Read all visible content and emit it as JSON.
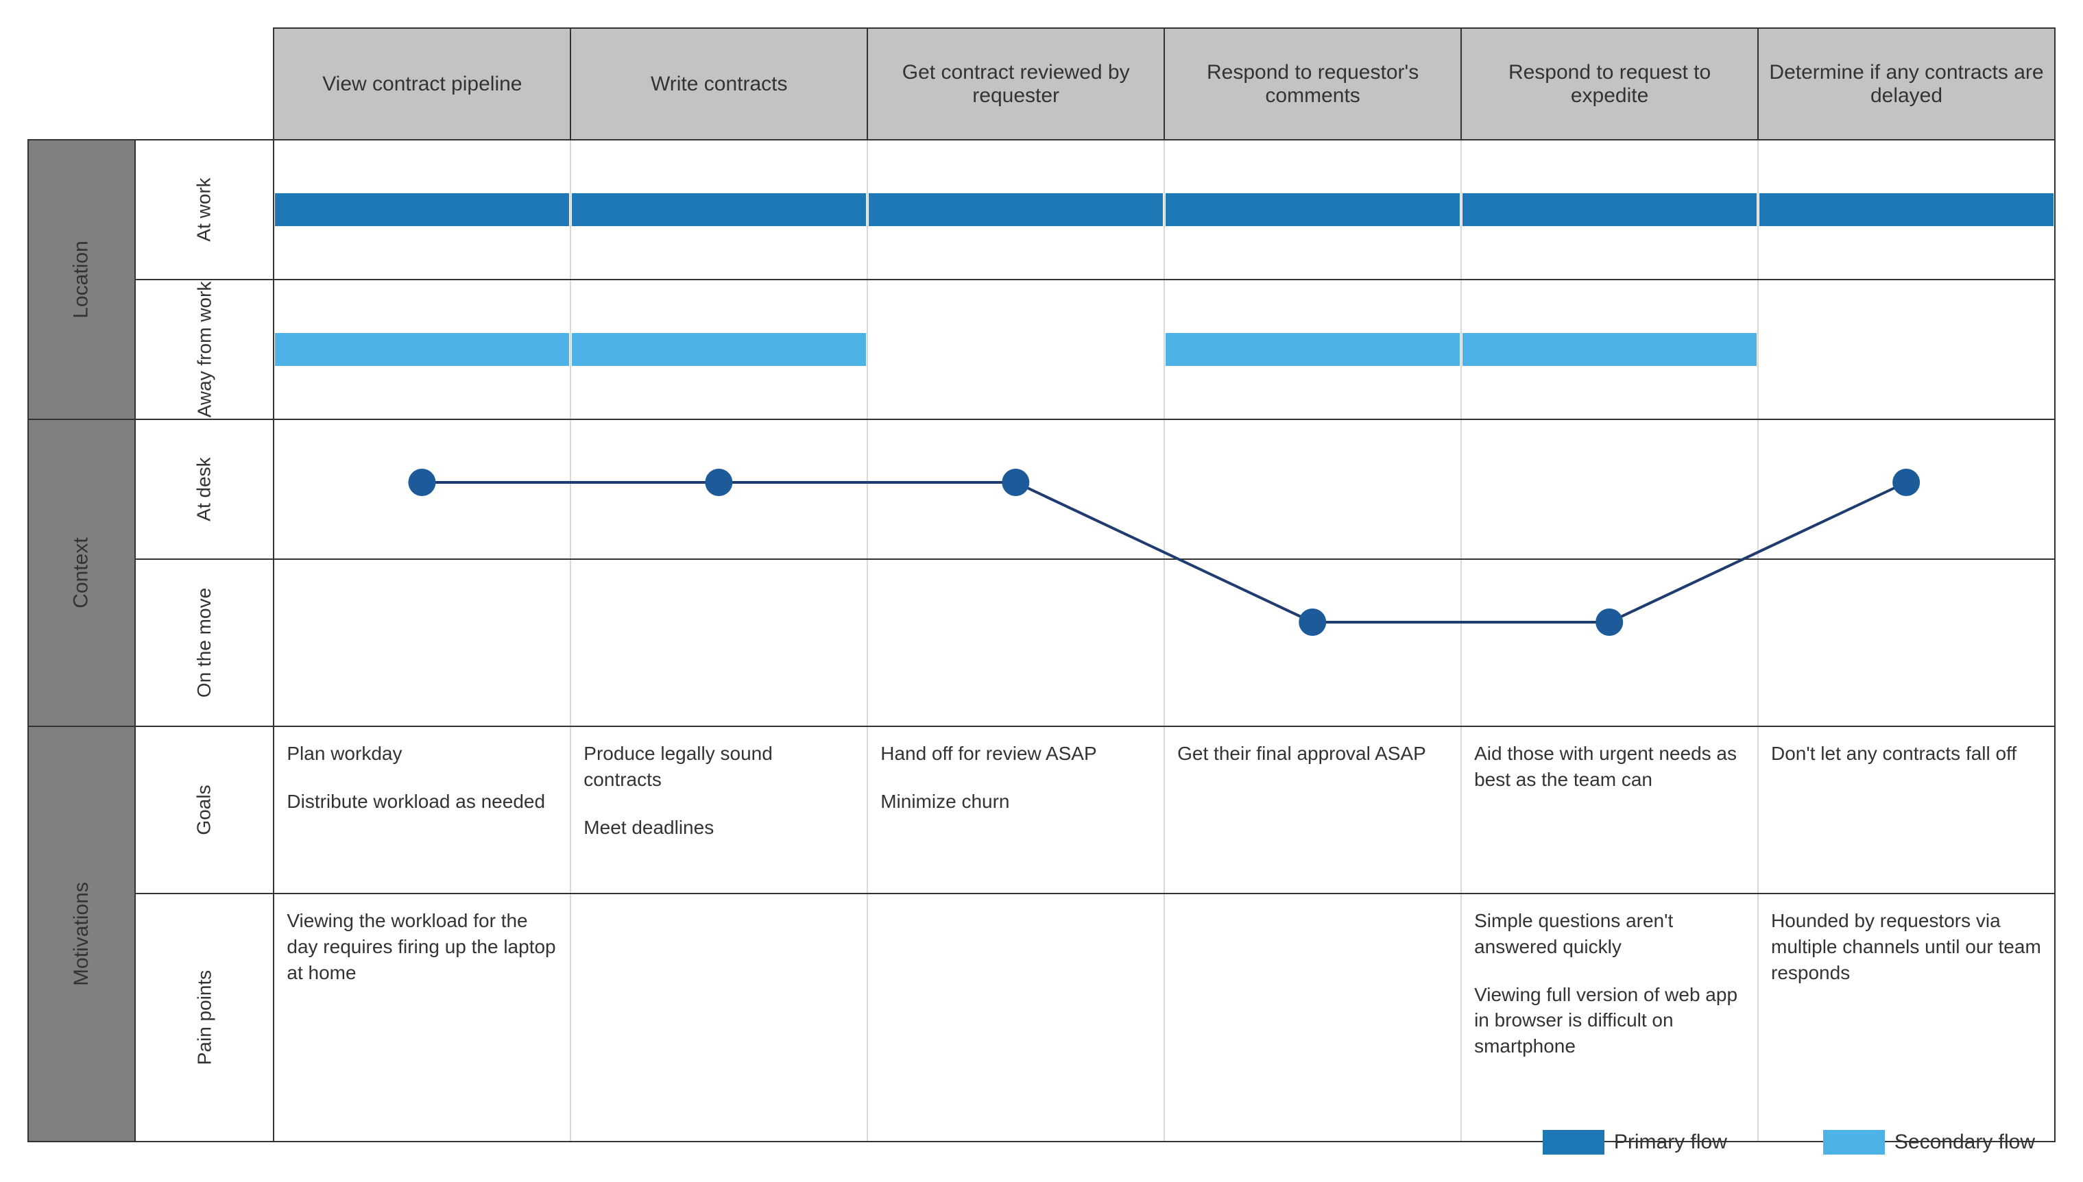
{
  "columns": [
    "View contract pipeline",
    "Write contracts",
    "Get contract reviewed by requester",
    "Respond to requestor's comments",
    "Respond to request to expedite",
    "Determine if any contracts are delayed"
  ],
  "sections": {
    "location": {
      "label": "Location",
      "rows": [
        {
          "label": "At work",
          "flow": "primary",
          "values": [
            true,
            true,
            true,
            true,
            true,
            true
          ]
        },
        {
          "label": "Away from work",
          "flow": "secondary",
          "values": [
            true,
            true,
            false,
            true,
            true,
            false
          ]
        }
      ]
    },
    "context": {
      "label": "Context",
      "rows": [
        {
          "label": "At desk"
        },
        {
          "label": "On the move"
        }
      ],
      "points": [
        "at_desk",
        "at_desk",
        "at_desk",
        "on_move",
        "on_move",
        "at_desk"
      ]
    },
    "motivations": {
      "label": "Motivations",
      "rows": [
        {
          "label": "Goals",
          "cells": [
            [
              "Plan workday",
              "Distribute workload as needed"
            ],
            [
              "Produce legally sound contracts",
              "Meet deadlines"
            ],
            [
              "Hand off for review ASAP",
              "Minimize churn"
            ],
            [
              "Get their final approval ASAP"
            ],
            [
              "Aid those with urgent needs as best as the team can"
            ],
            [
              "Don't let any contracts fall off"
            ]
          ]
        },
        {
          "label": "Pain points",
          "cells": [
            [
              "Viewing the workload for the day requires firing up the laptop at home"
            ],
            [],
            [],
            [],
            [
              "Simple questions aren't answered quickly",
              "Viewing full version of web app in browser is difficult on smartphone"
            ],
            [
              "Hounded by requestors via multiple channels until our team responds"
            ]
          ]
        }
      ]
    }
  },
  "legend": {
    "primary": "Primary flow",
    "secondary": "Secondary flow"
  },
  "chart_data": {
    "type": "table",
    "title": "Customer journey map – contract workflow",
    "columns": [
      "View contract pipeline",
      "Write contracts",
      "Get contract reviewed by requester",
      "Respond to requestor's comments",
      "Respond to request to expedite",
      "Determine if any contracts are delayed"
    ],
    "series": [
      {
        "name": "Location / At work (Primary flow)",
        "values": [
          1,
          1,
          1,
          1,
          1,
          1
        ]
      },
      {
        "name": "Location / Away from work (Secondary flow)",
        "values": [
          1,
          1,
          0,
          1,
          1,
          0
        ]
      },
      {
        "name": "Context (At desk = 1, On the move = 0)",
        "values": [
          1,
          1,
          1,
          0,
          0,
          1
        ]
      }
    ],
    "motivations": {
      "Goals": {
        "View contract pipeline": [
          "Plan workday",
          "Distribute workload as needed"
        ],
        "Write contracts": [
          "Produce legally sound contracts",
          "Meet deadlines"
        ],
        "Get contract reviewed by requester": [
          "Hand off for review ASAP",
          "Minimize churn"
        ],
        "Respond to requestor's comments": [
          "Get their final approval ASAP"
        ],
        "Respond to request to expedite": [
          "Aid those with urgent needs as best as the team can"
        ],
        "Determine if any contracts are delayed": [
          "Don't let any contracts fall off"
        ]
      },
      "Pain points": {
        "View contract pipeline": [
          "Viewing the workload for the day requires firing up the laptop at home"
        ],
        "Write contracts": [],
        "Get contract reviewed by requester": [],
        "Respond to requestor's comments": [],
        "Respond to request to expedite": [
          "Simple questions aren't answered quickly",
          "Viewing full version of web app in browser is difficult on smartphone"
        ],
        "Determine if any contracts are delayed": [
          "Hounded by requestors via multiple channels until our team responds"
        ]
      }
    },
    "legend": {
      "primary": "Primary flow",
      "secondary": "Secondary flow"
    }
  }
}
